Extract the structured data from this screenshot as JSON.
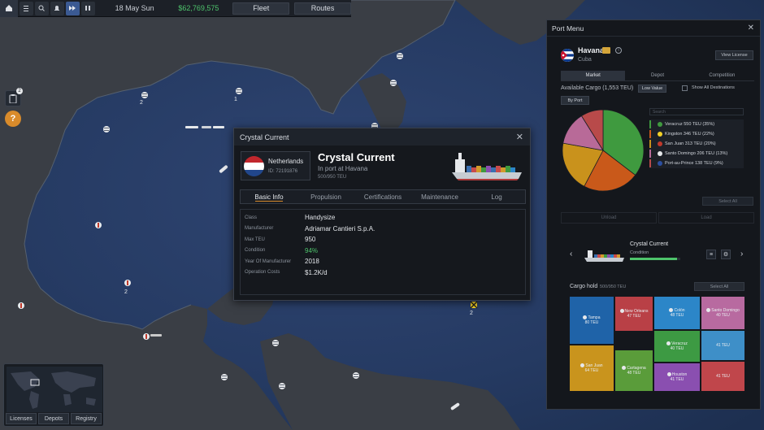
{
  "topbar": {
    "date": "18 May Sun",
    "money": "$62,769,575",
    "fleet_label": "Fleet",
    "routes_label": "Routes"
  },
  "map": {
    "port_counts": [
      "2",
      "1",
      "2",
      "2"
    ],
    "side_badge": "2"
  },
  "minimap": {
    "licenses_label": "Licenses",
    "depots_label": "Depots",
    "registry_label": "Registry"
  },
  "ship_dialog": {
    "title": "Crystal Current",
    "country": "Netherlands",
    "ship_id": "ID: 72191876",
    "name": "Crystal Current",
    "status": "In port at Havana",
    "teu": "500/950 TEU",
    "tabs": [
      "Basic Info",
      "Propulsion",
      "Certifications",
      "Maintenance",
      "Log"
    ],
    "active_tab": "Basic Info",
    "info": [
      {
        "label": "Class",
        "value": "Handysize"
      },
      {
        "label": "Manufacturer",
        "value": "Adriamar Cantieri S.p.A."
      },
      {
        "label": "Max TEU",
        "value": "950"
      },
      {
        "label": "Condition",
        "value": "94%"
      },
      {
        "label": "Year Of Manufacturer",
        "value": "2018"
      },
      {
        "label": "Operation Costs",
        "value": "$1.2K/d"
      }
    ]
  },
  "port_menu": {
    "title": "Port Menu",
    "port_name": "Havana",
    "port_country": "Cuba",
    "view_license": "View License",
    "tabs": [
      "Market",
      "Depot",
      "Competition"
    ],
    "active_tab": "Market",
    "available_cargo": "Available Cargo (1,553 TEU)",
    "low_value": "Low Value",
    "show_all": "Show All Destinations",
    "by_port": "By Port",
    "search_placeholder": "Search",
    "destinations": [
      {
        "label": "Veracruz  550 TEU  (35%)",
        "color": "#3f9a3f"
      },
      {
        "label": "Kingston  346 TEU  (22%)",
        "color": "#d27a1c"
      },
      {
        "label": "San Juan  313 TEU  (20%)",
        "color": "#c9921c"
      },
      {
        "label": "Santo Domingo  206 TEU  (13%)",
        "color": "#b86a98"
      },
      {
        "label": "Port-au-Prince  138 TEU  (9%)",
        "color": "#b84a4a"
      }
    ],
    "chart_data": {
      "type": "pie",
      "categories": [
        "Veracruz",
        "Kingston",
        "San Juan",
        "Santo Domingo",
        "Port-au-Prince"
      ],
      "values": [
        550,
        346,
        313,
        206,
        138
      ],
      "colors": [
        "#3f9a3f",
        "#c9591a",
        "#c9921c",
        "#b86a98",
        "#b84a4a"
      ]
    },
    "select_all": "Select All",
    "unload": "Unload",
    "load": "Load",
    "selected_ship": "Crystal Current",
    "condition_label": "Condition",
    "condition": 0.94,
    "cargo_hold": "Cargo hold",
    "cargo_teu": "500/950 TEU",
    "select_all_2": "Select All",
    "hold_tiles": [
      {
        "name": "Tampa",
        "teu": "80 TEU",
        "color": "#1f63a8"
      },
      {
        "name": "New Orleans",
        "teu": "47 TEU",
        "color": "#b94046"
      },
      {
        "name": "Colón",
        "teu": "48 TEU",
        "color": "#2c86c8"
      },
      {
        "name": "Santo Domingo",
        "teu": "40 TEU",
        "color": "#b86aa0"
      },
      {
        "name": "Veracruz",
        "teu": "40 TEU",
        "color": "#3d9a43"
      },
      {
        "name": "",
        "teu": "41 TEU",
        "color": "#3e8fc8"
      },
      {
        "name": "San Juan",
        "teu": "64 TEU",
        "color": "#c9941d"
      },
      {
        "name": "Cartagena",
        "teu": "48 TEU",
        "color": "#5a9c3a"
      },
      {
        "name": "Houston",
        "teu": "41 TEU",
        "color": "#8a4fb0"
      },
      {
        "name": "",
        "teu": "41 TEU",
        "color": "#c0464b"
      }
    ]
  }
}
